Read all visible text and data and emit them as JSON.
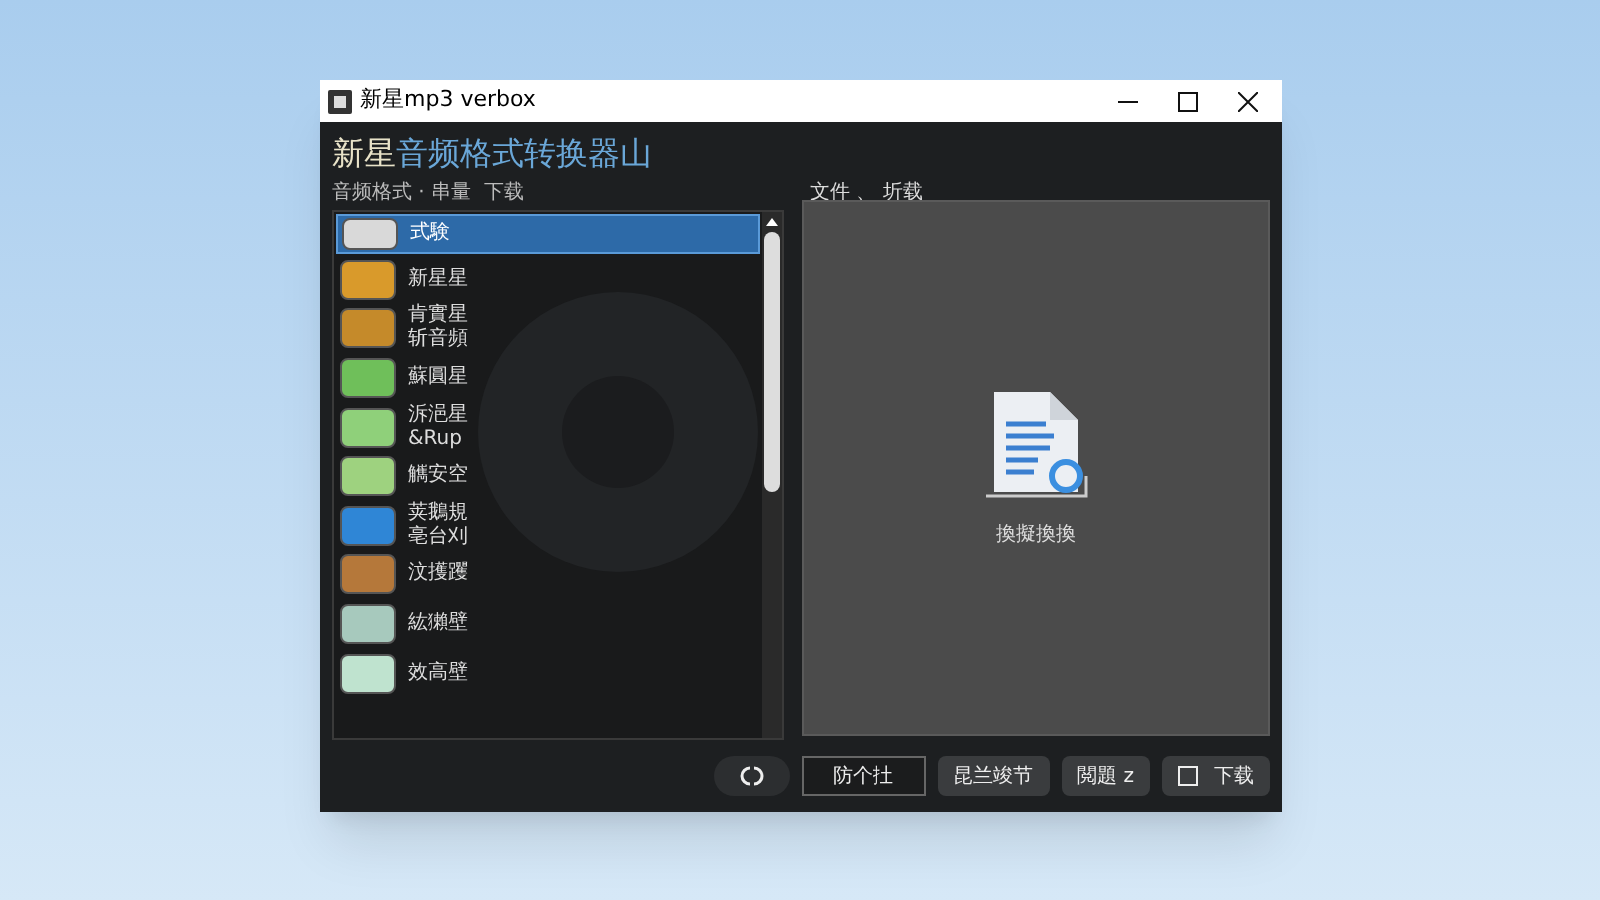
{
  "window": {
    "title": "新星mp3 verbox"
  },
  "header": {
    "brand": "新星",
    "title": "音频格式转换器山",
    "subtitle": "音频格式 · 串量  下载"
  },
  "list": {
    "items": [
      {
        "lines": [
          "式験"
        ],
        "selected": true,
        "color": "#d9d9d9"
      },
      {
        "lines": [
          "新星星"
        ],
        "selected": false,
        "color": "#d99a2b"
      },
      {
        "lines": [
          "肯實星",
          "斩音頻"
        ],
        "selected": false,
        "color": "#c58a2a"
      },
      {
        "lines": [
          "蘇圓星"
        ],
        "selected": false,
        "color": "#6fbf5a"
      },
      {
        "lines": [
          "泝浥星",
          "&Rup"
        ],
        "selected": false,
        "color": "#8fd07a"
      },
      {
        "lines": [
          "觽安空"
        ],
        "selected": false,
        "color": "#9ed27f"
      },
      {
        "lines": [
          "荚鵝規",
          "亳台刈"
        ],
        "selected": false,
        "color": "#2f86d6"
      },
      {
        "lines": [
          "汶擭躩"
        ],
        "selected": false,
        "color": "#b5783a"
      },
      {
        "lines": [
          "紘獺壁"
        ],
        "selected": false,
        "color": "#a7c9bd"
      },
      {
        "lines": [
          "效高壁"
        ],
        "selected": false,
        "color": "#bfe3cf"
      }
    ]
  },
  "panel": {
    "label": "文件 、 圻载",
    "file_caption": "換擬換換"
  },
  "buttons": [
    {
      "kind": "icon"
    },
    {
      "kind": "outlined",
      "label": "防个扗"
    },
    {
      "kind": "plain",
      "label": "昆兰竣节"
    },
    {
      "kind": "plain",
      "label": "閲題 z"
    },
    {
      "kind": "icon-label",
      "label": "下载"
    }
  ]
}
